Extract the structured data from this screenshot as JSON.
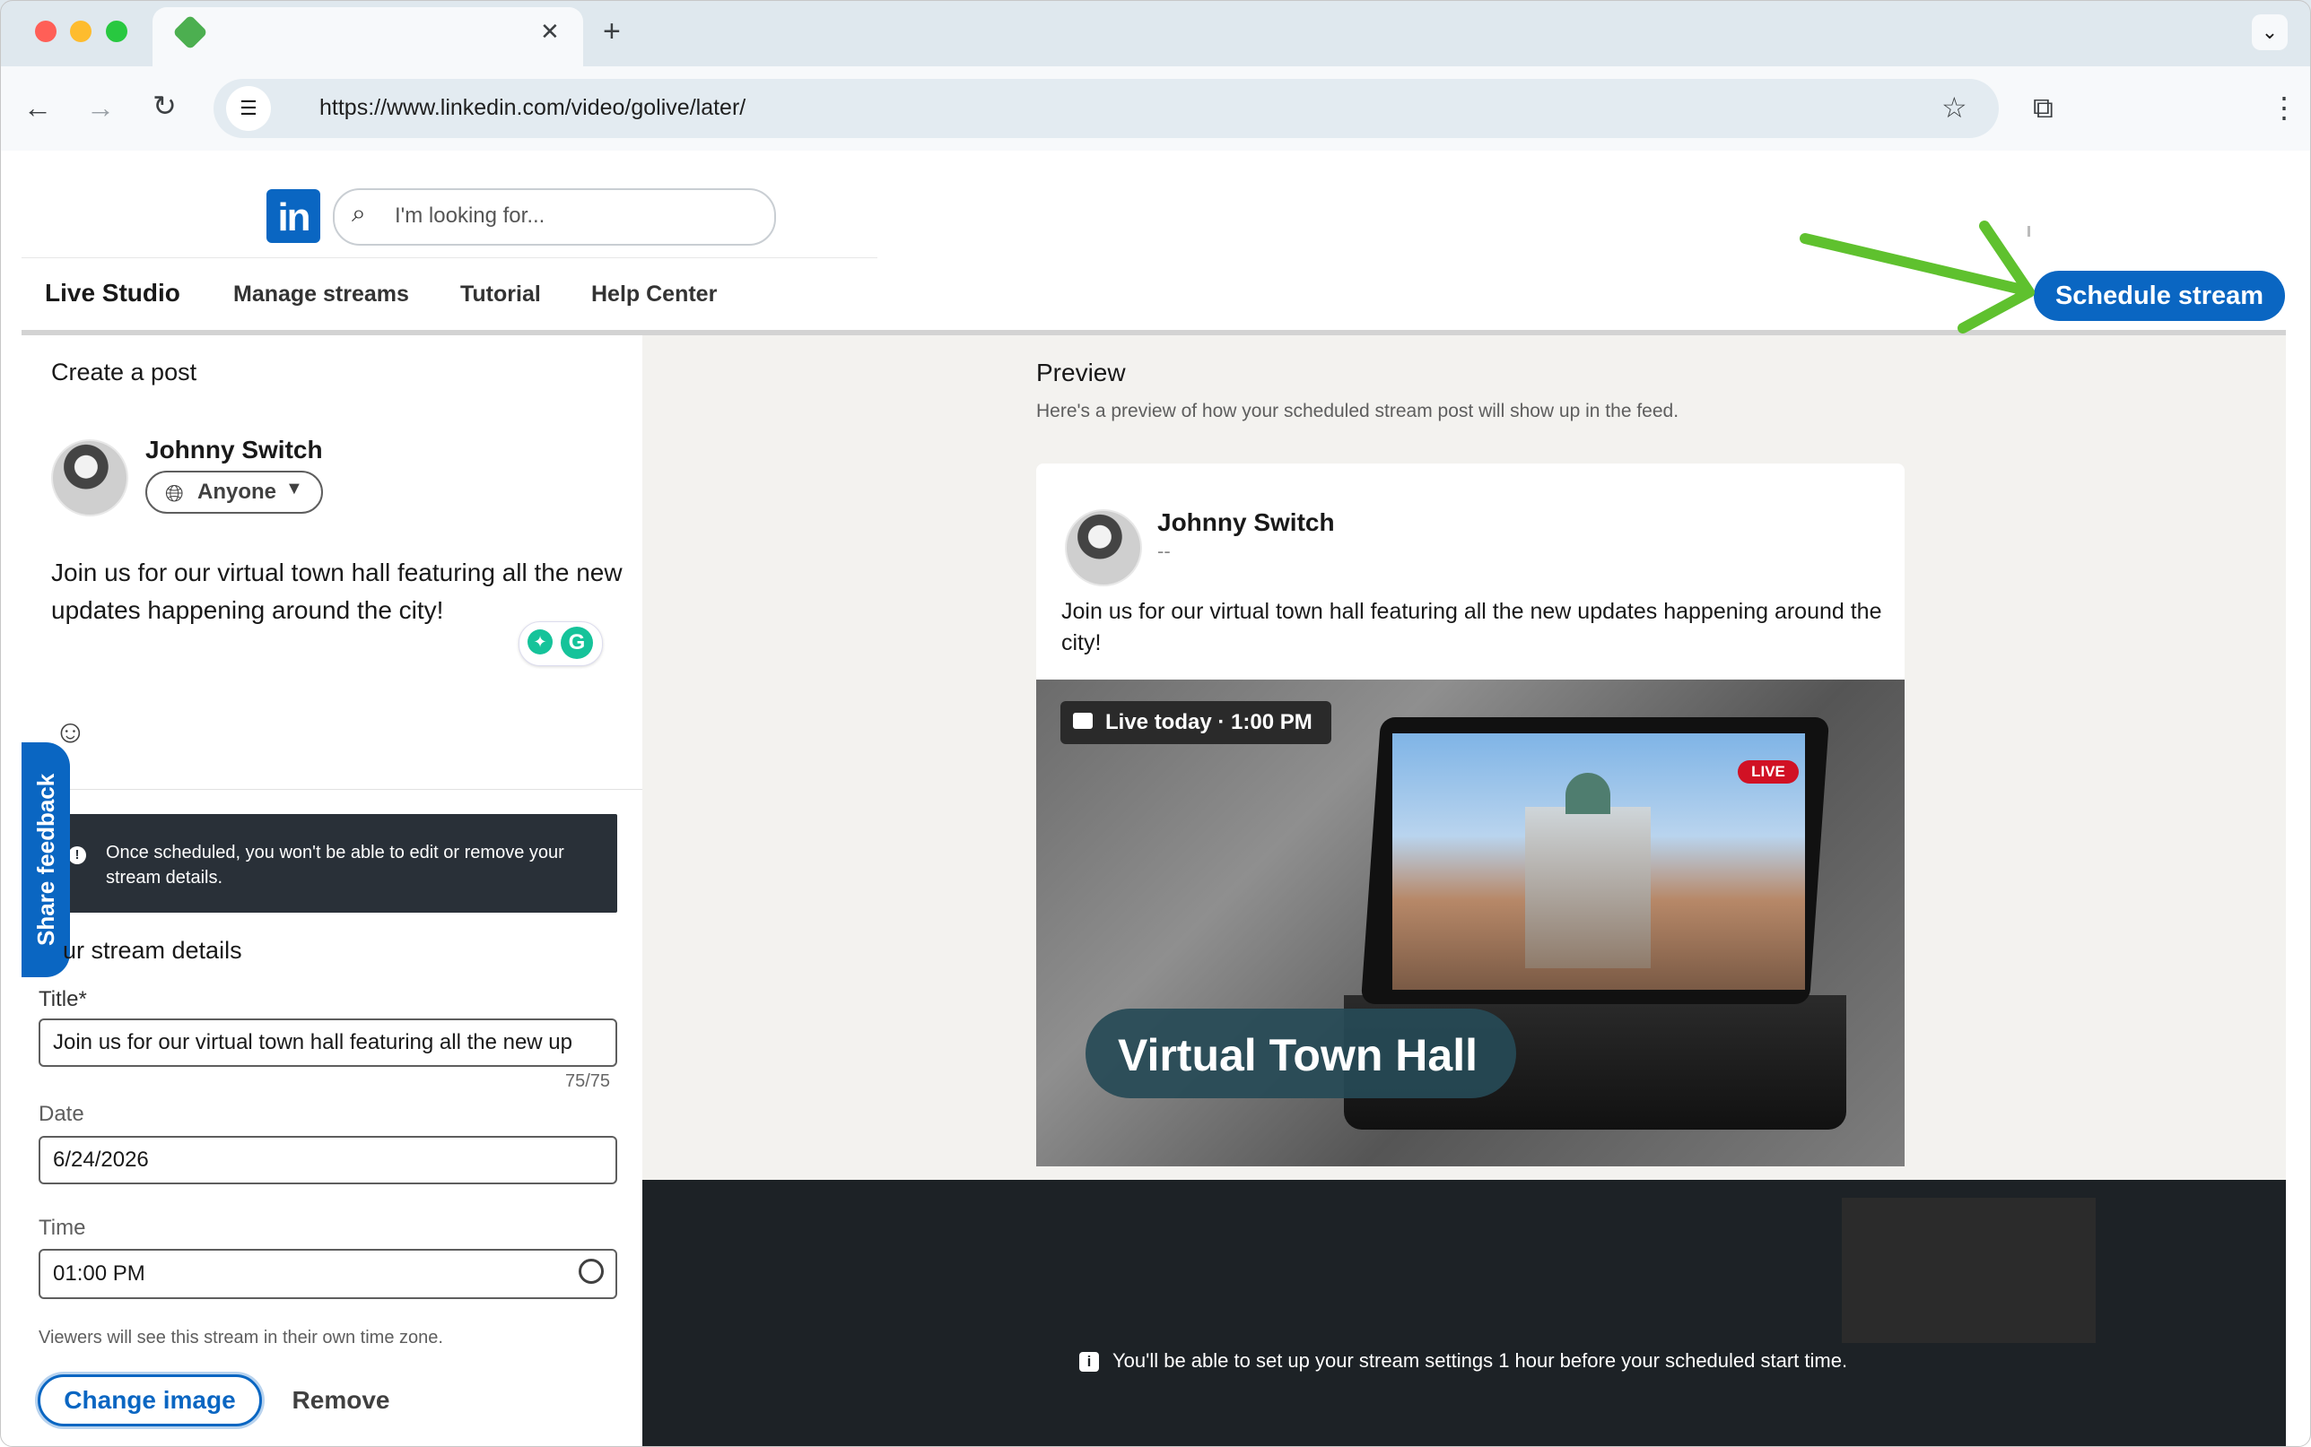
{
  "browser": {
    "url": "https://www.linkedin.com/video/golive/later/",
    "tab_close": "✕",
    "new_tab": "+"
  },
  "header": {
    "logo_text": "in",
    "search_placeholder": "I'm looking for..."
  },
  "nav": {
    "items": [
      "Live Studio",
      "Manage streams",
      "Tutorial",
      "Help Center"
    ],
    "schedule_button": "Schedule stream"
  },
  "create_post": {
    "heading": "Create a post",
    "author": "Johnny Switch",
    "visibility": "Anyone",
    "text": "Join us for our virtual town hall featuring all the new updates happening around the city!"
  },
  "warning": {
    "text": "Once scheduled, you won't be able to edit or remove your stream details."
  },
  "share_feedback": "Share feedback",
  "stream_details": {
    "heading": "ur stream details",
    "title_label": "Title*",
    "title_value": "Join us for our virtual town hall featuring all the new up",
    "char_count": "75/75",
    "date_label": "Date",
    "date_value": "6/24/2026",
    "time_label": "Time",
    "time_value": "01:00 PM",
    "tz_note": "Viewers will see this stream in their own time zone.",
    "change_image": "Change image",
    "remove": "Remove"
  },
  "preview": {
    "title": "Preview",
    "subtitle": "Here's a preview of how your scheduled stream post will show up in the feed.",
    "author": "Johnny Switch",
    "dash": "--",
    "text": "Join us for our virtual town hall featuring all the new updates happening around the city!",
    "live_today": "Live today · 1:00 PM",
    "live_badge": "LIVE",
    "thumbnail_title": "Virtual Town Hall"
  },
  "footer_note": "You'll be able to set up your stream settings 1 hour before your scheduled start time.",
  "colors": {
    "brand": "#0a66c2",
    "arrow": "#5fc12e",
    "dark": "#1d2226"
  }
}
